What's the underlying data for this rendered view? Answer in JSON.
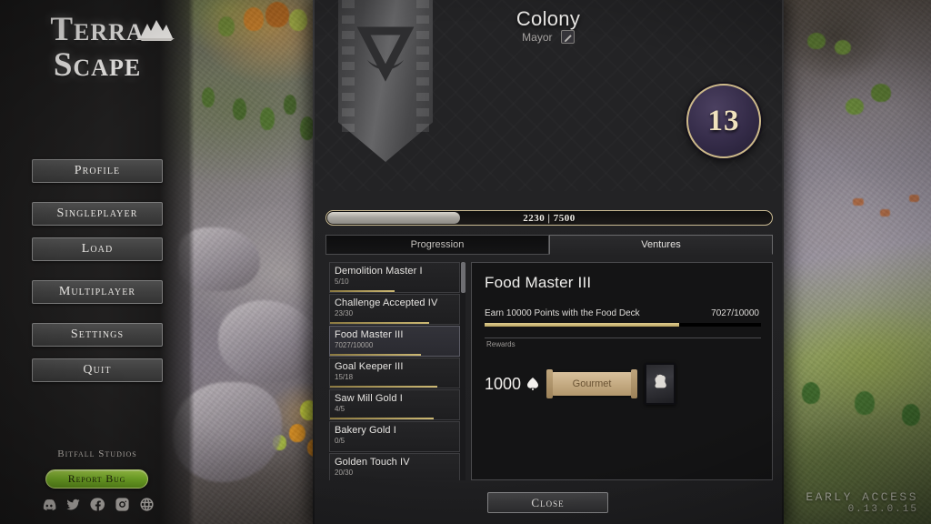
{
  "brand": {
    "logo_line1": "Terra",
    "logo_line2": "Scape",
    "logo_mark_icon": "mountain-peaks-icon",
    "studio": "Bitfall Studios",
    "report_bug_label": "Report Bug",
    "report_bug_color": "#7db72b"
  },
  "main_menu": {
    "items": [
      {
        "label": "Profile"
      },
      {
        "label": "Singleplayer"
      },
      {
        "label": "Load"
      },
      {
        "label": "Multiplayer"
      },
      {
        "label": "Settings"
      },
      {
        "label": "Quit"
      }
    ]
  },
  "socials": [
    {
      "name": "discord-icon"
    },
    {
      "name": "twitter-icon"
    },
    {
      "name": "facebook-icon"
    },
    {
      "name": "instagram-icon"
    },
    {
      "name": "website-globe-icon"
    }
  ],
  "profile_panel": {
    "banner_icon": "faction-banner-triangle-crescent-icon",
    "title": "Colony",
    "subtitle": "Mayor",
    "edit_icon": "edit-pencil-icon",
    "level": "13",
    "xp": {
      "current": 2230,
      "max": 7500,
      "text": "2230  |  7500",
      "percent": 29.7
    },
    "tabs": [
      {
        "label": "Progression",
        "active": false
      },
      {
        "label": "Ventures",
        "active": true
      }
    ],
    "achievements": [
      {
        "name": "Demolition Master I",
        "progress_text": "5/10",
        "percent": 50,
        "selected": false
      },
      {
        "name": "Challenge Accepted IV",
        "progress_text": "23/30",
        "percent": 76.7,
        "selected": false
      },
      {
        "name": "Food Master III",
        "progress_text": "7027/10000",
        "percent": 70.3,
        "selected": true
      },
      {
        "name": "Goal Keeper III",
        "progress_text": "15/18",
        "percent": 83.3,
        "selected": false
      },
      {
        "name": "Saw Mill Gold I",
        "progress_text": "4/5",
        "percent": 80,
        "selected": false
      },
      {
        "name": "Bakery Gold I",
        "progress_text": "0/5",
        "percent": 0,
        "selected": false
      },
      {
        "name": "Golden Touch IV",
        "progress_text": "20/30",
        "percent": 66.7,
        "selected": false
      }
    ],
    "detail": {
      "title": "Food Master III",
      "task": "Earn 10000 Points with the Food Deck",
      "count": "7027/10000",
      "percent": 70.3,
      "rewards_label": "Rewards",
      "rewards": {
        "currency_amount": "1000",
        "currency_icon": "spade-token-icon",
        "scroll_label": "Gourmet",
        "card_icon": "chicken-card-icon"
      }
    },
    "close_label": "Close"
  },
  "version": {
    "stage": "EARLY ACCESS",
    "number": "0.13.0.15"
  }
}
